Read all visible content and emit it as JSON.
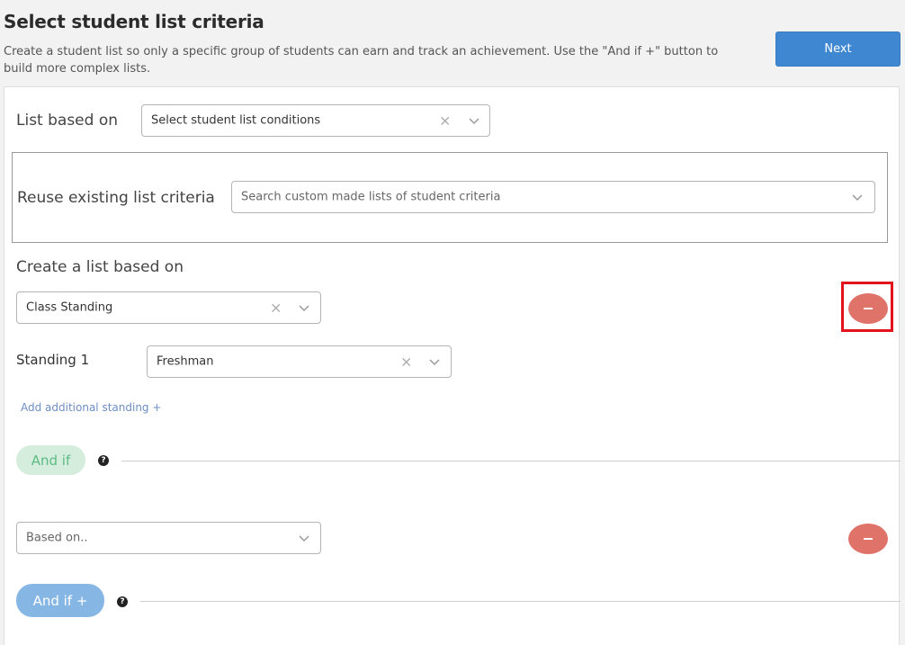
{
  "header": {
    "title": "Select student list criteria",
    "description": "Create a student list so only a specific group of students can earn and track an achievement. Use the \"And if +\" button to build more complex lists.",
    "next_label": "Next"
  },
  "list_based_on": {
    "label": "List based on",
    "value": "Select student list conditions"
  },
  "reuse": {
    "label": "Reuse existing list criteria",
    "placeholder": "Search custom made lists of student criteria"
  },
  "create": {
    "label": "Create a list based on",
    "value": "Class Standing"
  },
  "standing": {
    "label": "Standing 1",
    "value": "Freshman",
    "add_link": "Add additional standing +"
  },
  "and_if_1": {
    "label": "And if"
  },
  "based_on": {
    "placeholder": "Based on.."
  },
  "and_if_2": {
    "label": "And if +"
  },
  "icons": {
    "clear": "×",
    "help": "?"
  },
  "colors": {
    "primary": "#3f87d1",
    "remove": "#e07369",
    "and_if_green": "#d4eddd",
    "and_if_blue": "#86b6e4",
    "highlight": "#e3131e"
  }
}
